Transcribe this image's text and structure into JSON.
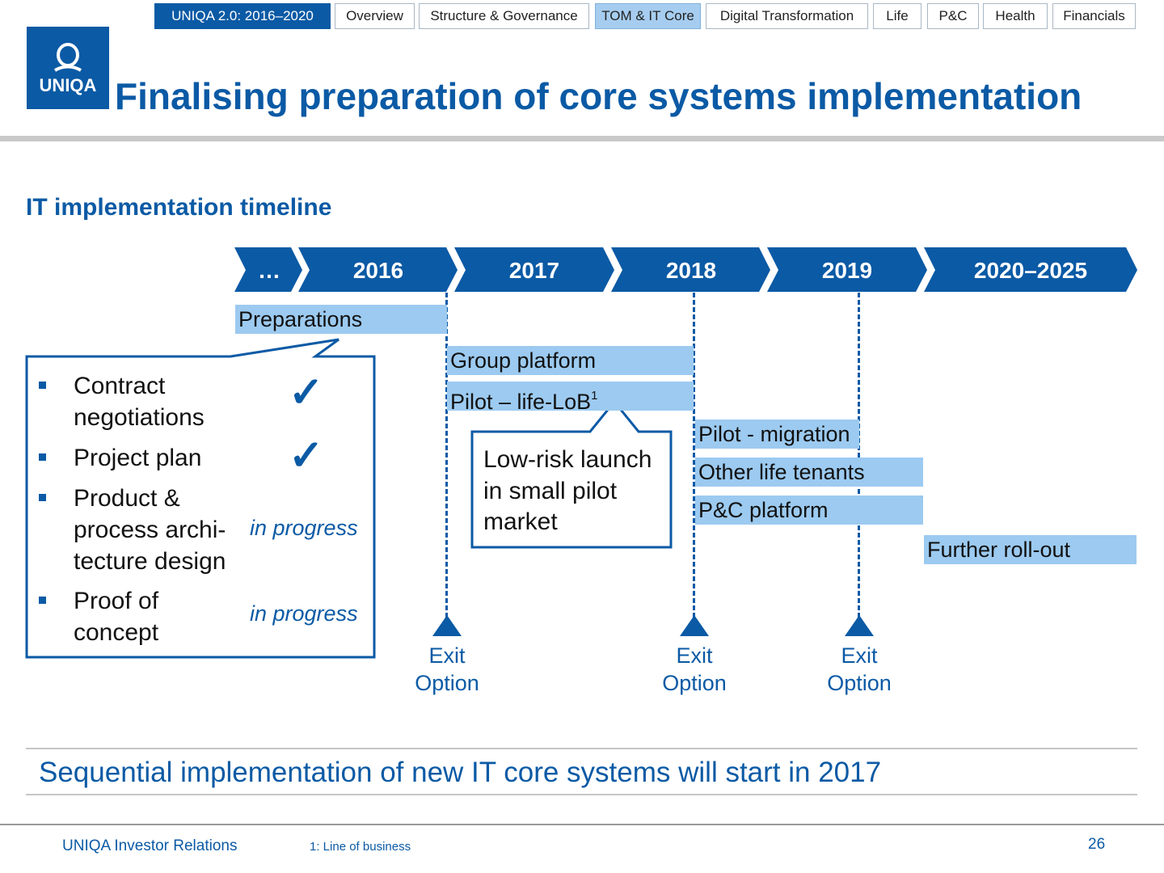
{
  "nav": {
    "home": "UNIQA 2.0: 2016–2020",
    "tabs": [
      "Overview",
      "Structure & Governance",
      "TOM & IT Core",
      "Digital Transformation",
      "Life",
      "P&C",
      "Health",
      "Financials"
    ],
    "active_tab": "TOM & IT Core"
  },
  "logo": {
    "text": "UNIQA"
  },
  "header": {
    "title": "Finalising preparation of core systems implementation"
  },
  "section": {
    "subtitle": "IT implementation timeline"
  },
  "timeline": {
    "periods": [
      "…",
      "2016",
      "2017",
      "2018",
      "2019",
      "2020–2025"
    ],
    "bars": [
      {
        "label": "Preparations",
        "start": "2016",
        "end": "2016"
      },
      {
        "label": "Group platform",
        "start": "2017",
        "end": "2017"
      },
      {
        "label": "Pilot – life-LoB",
        "sup": "1",
        "start": "2017",
        "end": "2017"
      },
      {
        "label": "Pilot - migration",
        "start": "2018",
        "end": "2018"
      },
      {
        "label": "Other life tenants",
        "start": "2018",
        "end": "2019"
      },
      {
        "label": "P&C platform",
        "start": "2018",
        "end": "2019"
      },
      {
        "label": "Further roll-out",
        "start": "2020–2025",
        "end": "2020–2025"
      }
    ],
    "exit_options": [
      {
        "line1": "Exit",
        "line2": "Option",
        "after": "2016"
      },
      {
        "line1": "Exit",
        "line2": "Option",
        "after": "2017"
      },
      {
        "line1": "Exit",
        "line2": "Option",
        "after": "2018"
      }
    ]
  },
  "preparations_box": {
    "items": [
      {
        "lines": [
          "Contract",
          "negotiations"
        ],
        "status": "done",
        "status_icon": "checkmark-icon"
      },
      {
        "lines": [
          "Project plan"
        ],
        "status": "done",
        "status_icon": "checkmark-icon"
      },
      {
        "lines": [
          "Product &",
          "process archi-",
          "tecture design"
        ],
        "status": "in progress"
      },
      {
        "lines": [
          "Proof of",
          "concept"
        ],
        "status": "in progress"
      }
    ]
  },
  "callout": {
    "lines": [
      "Low-risk launch",
      "in small pilot",
      "market"
    ]
  },
  "conclusion": "Sequential implementation of new IT core systems will start in 2017",
  "footer": {
    "left": "UNIQA Investor Relations",
    "footnote": "1: Line of business",
    "page": "26"
  },
  "colors": {
    "brand_blue": "#0b5aa5",
    "bar_light_blue": "#9ccaf0",
    "active_tab": "#a6cdf0"
  }
}
